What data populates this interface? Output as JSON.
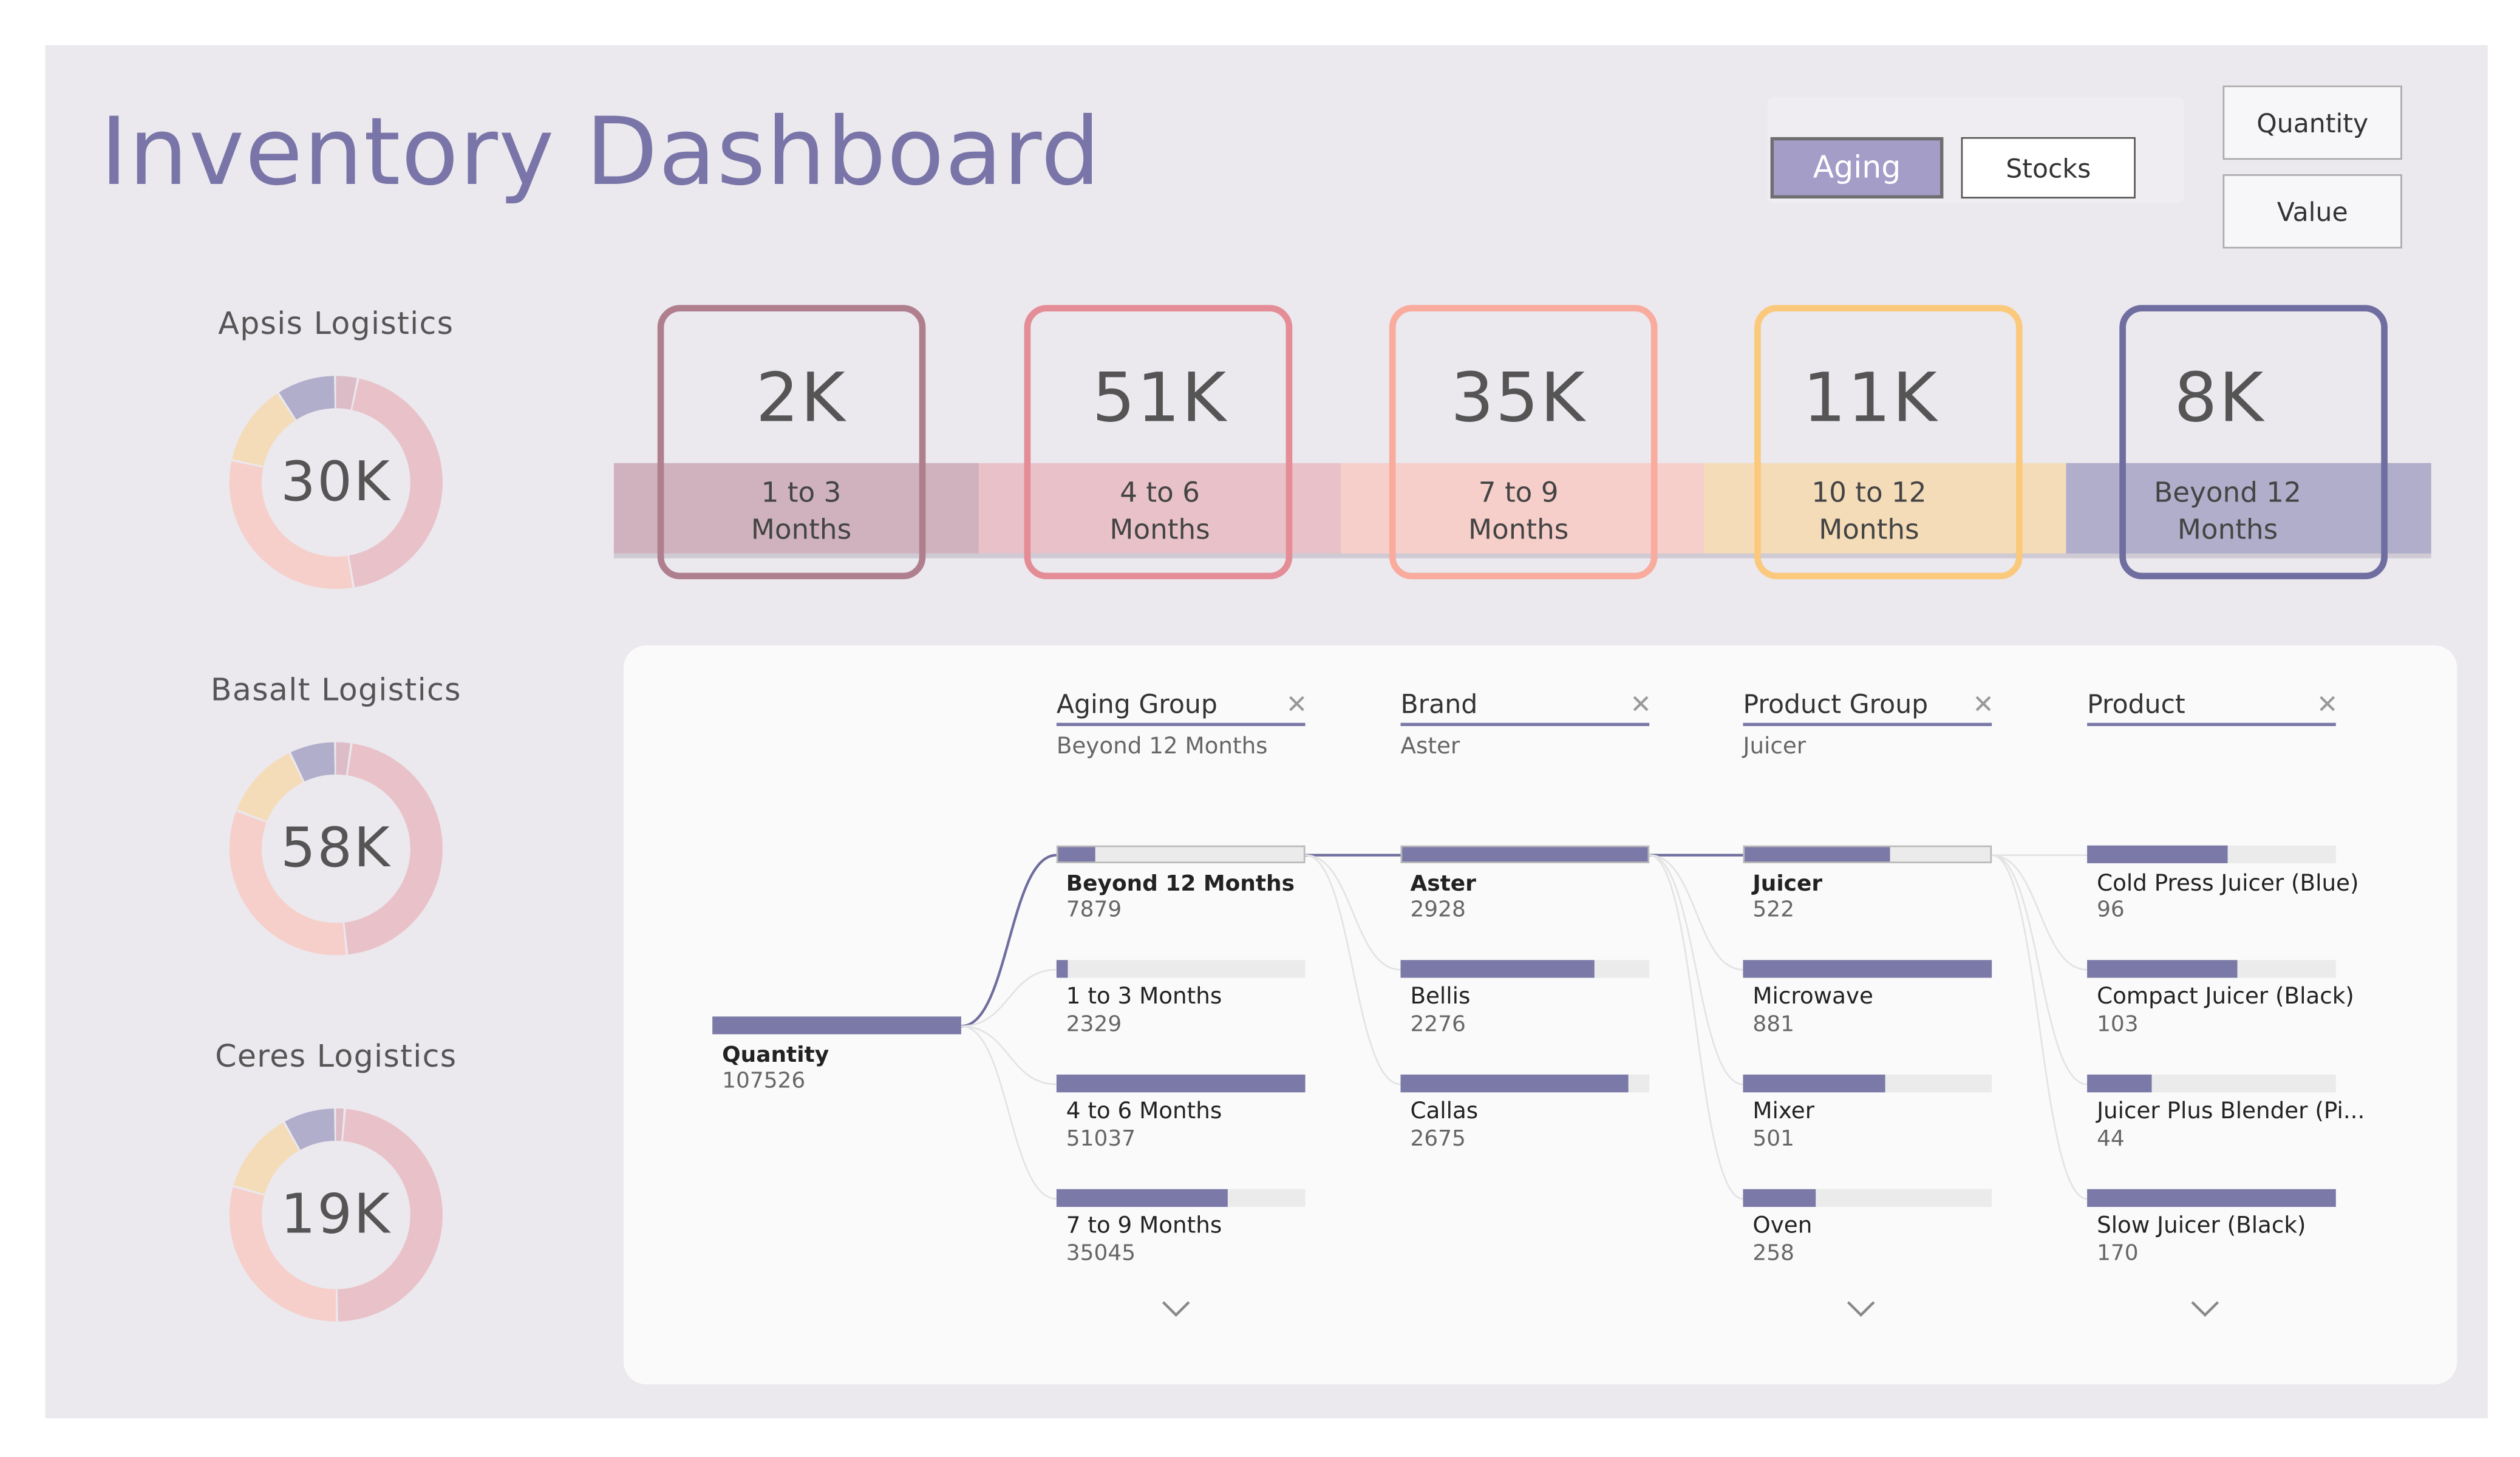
{
  "title": "Inventory Dashboard",
  "toggle": {
    "aging_label": "Aging",
    "stocks_label": "Stocks"
  },
  "measure": {
    "quantity_label": "Quantity",
    "value_label": "Value"
  },
  "colors": {
    "band_1_3": "#cfb2bd",
    "band_4_6": "#e9c2c9",
    "band_7_9": "#f6cfca",
    "band_10_12": "#f4dcb9",
    "band_beyond": "#b0aecb",
    "border_1_3": "#b07f8d",
    "border_4_6": "#e48d97",
    "border_7_9": "#f9ab9d",
    "border_10_12": "#fbc97b",
    "border_beyond": "#706ea0",
    "bar": "#7b79a7",
    "title": "#7a75a8"
  },
  "donuts": [
    {
      "name": "Apsis Logistics",
      "total": "30K",
      "segments": [
        {
          "key": "1 to 3 Months",
          "share": 0.035,
          "color": "#dcbcc7"
        },
        {
          "key": "4 to 6 Months",
          "share": 0.44,
          "color": "#e9c2c9"
        },
        {
          "key": "7 to 9 Months",
          "share": 0.31,
          "color": "#f6cfca"
        },
        {
          "key": "10 to 12 Months",
          "share": 0.125,
          "color": "#f4dcb9"
        },
        {
          "key": "Beyond 12 Months",
          "share": 0.09,
          "color": "#b0aecb"
        }
      ]
    },
    {
      "name": "Basalt Logistics",
      "total": "58K",
      "segments": [
        {
          "key": "1 to 3 Months",
          "share": 0.025,
          "color": "#dcbcc7"
        },
        {
          "key": "4 to 6 Months",
          "share": 0.46,
          "color": "#e9c2c9"
        },
        {
          "key": "7 to 9 Months",
          "share": 0.325,
          "color": "#f6cfca"
        },
        {
          "key": "10 to 12 Months",
          "share": 0.12,
          "color": "#f4dcb9"
        },
        {
          "key": "Beyond 12 Months",
          "share": 0.07,
          "color": "#b0aecb"
        }
      ]
    },
    {
      "name": "Ceres Logistics",
      "total": "19K",
      "segments": [
        {
          "key": "1 to 3 Months",
          "share": 0.015,
          "color": "#dcbcc7"
        },
        {
          "key": "4 to 6 Months",
          "share": 0.485,
          "color": "#e9c2c9"
        },
        {
          "key": "7 to 9 Months",
          "share": 0.295,
          "color": "#f6cfca"
        },
        {
          "key": "10 to 12 Months",
          "share": 0.125,
          "color": "#f4dcb9"
        },
        {
          "key": "Beyond 12 Months",
          "share": 0.08,
          "color": "#b0aecb"
        }
      ]
    }
  ],
  "kpis": [
    {
      "value": "2K",
      "label_line1": "1 to 3",
      "label_line2": "Months"
    },
    {
      "value": "51K",
      "label_line1": "4 to 6",
      "label_line2": "Months"
    },
    {
      "value": "35K",
      "label_line1": "7 to 9",
      "label_line2": "Months"
    },
    {
      "value": "11K",
      "label_line1": "10 to 12",
      "label_line2": "Months"
    },
    {
      "value": "8K",
      "label_line1": "Beyond 12",
      "label_line2": "Months"
    }
  ],
  "tree": {
    "root": {
      "label": "Quantity",
      "value": "107526",
      "fraction": 1.0
    },
    "levels": [
      {
        "header": "Aging Group",
        "selected": "Beyond 12 Months",
        "nodes": [
          {
            "label": "Beyond 12 Months",
            "value": "7879",
            "fraction": 0.154,
            "selected": true
          },
          {
            "label": "1 to 3 Months",
            "value": "2329",
            "fraction": 0.046
          },
          {
            "label": "4 to 6 Months",
            "value": "51037",
            "fraction": 1.0
          },
          {
            "label": "7 to 9 Months",
            "value": "35045",
            "fraction": 0.687
          }
        ]
      },
      {
        "header": "Brand",
        "selected": "Aster",
        "nodes": [
          {
            "label": "Aster",
            "value": "2928",
            "fraction": 1.0,
            "selected": true
          },
          {
            "label": "Bellis",
            "value": "2276",
            "fraction": 0.777
          },
          {
            "label": "Callas",
            "value": "2675",
            "fraction": 0.914
          }
        ]
      },
      {
        "header": "Product Group",
        "selected": "Juicer",
        "nodes": [
          {
            "label": "Juicer",
            "value": "522",
            "fraction": 0.592,
            "selected": true
          },
          {
            "label": "Microwave",
            "value": "881",
            "fraction": 1.0
          },
          {
            "label": "Mixer",
            "value": "501",
            "fraction": 0.569
          },
          {
            "label": "Oven",
            "value": "258",
            "fraction": 0.293
          }
        ]
      },
      {
        "header": "Product",
        "selected": "",
        "nodes": [
          {
            "label": "Cold Press Juicer (Blue)",
            "value": "96",
            "fraction": 0.565
          },
          {
            "label": "Compact Juicer (Black)",
            "value": "103",
            "fraction": 0.606
          },
          {
            "label": "Juicer Plus Blender (Pi...",
            "value": "44",
            "fraction": 0.259
          },
          {
            "label": "Slow Juicer (Black)",
            "value": "170",
            "fraction": 1.0
          }
        ]
      }
    ]
  }
}
